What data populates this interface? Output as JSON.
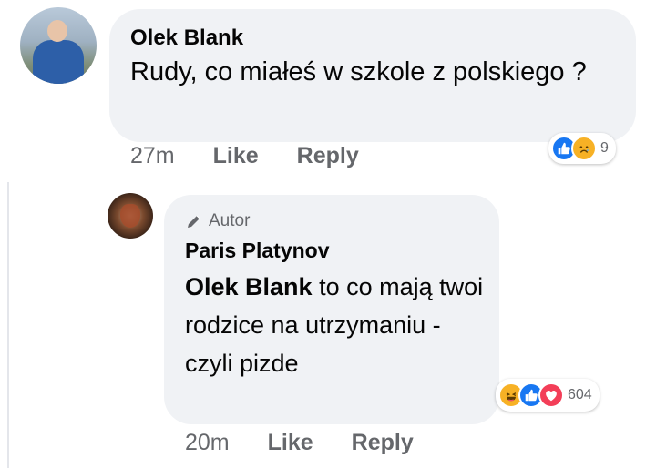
{
  "comment": {
    "author": "Olek Blank",
    "text": "Rudy, co miałeś w szkole z polskiego ?",
    "time": "27m",
    "like_label": "Like",
    "reply_label": "Reply",
    "reaction_count": "9",
    "reactions": [
      "like-icon",
      "sad-icon"
    ]
  },
  "reply": {
    "badge": "Autor",
    "author": "Paris Platynov",
    "mention": "Olek Blank",
    "text": " to co mają twoi rodzice na utrzymaniu - czyli pizde",
    "time": "20m",
    "like_label": "Like",
    "reply_label": "Reply",
    "reaction_count": "604",
    "reactions": [
      "haha-icon",
      "like-icon",
      "love-icon"
    ]
  },
  "colors": {
    "bubble": "#f0f2f5",
    "meta_text": "#65676b",
    "like": "#1877f2",
    "love": "#f33e58",
    "emoji": "#f7b125"
  }
}
